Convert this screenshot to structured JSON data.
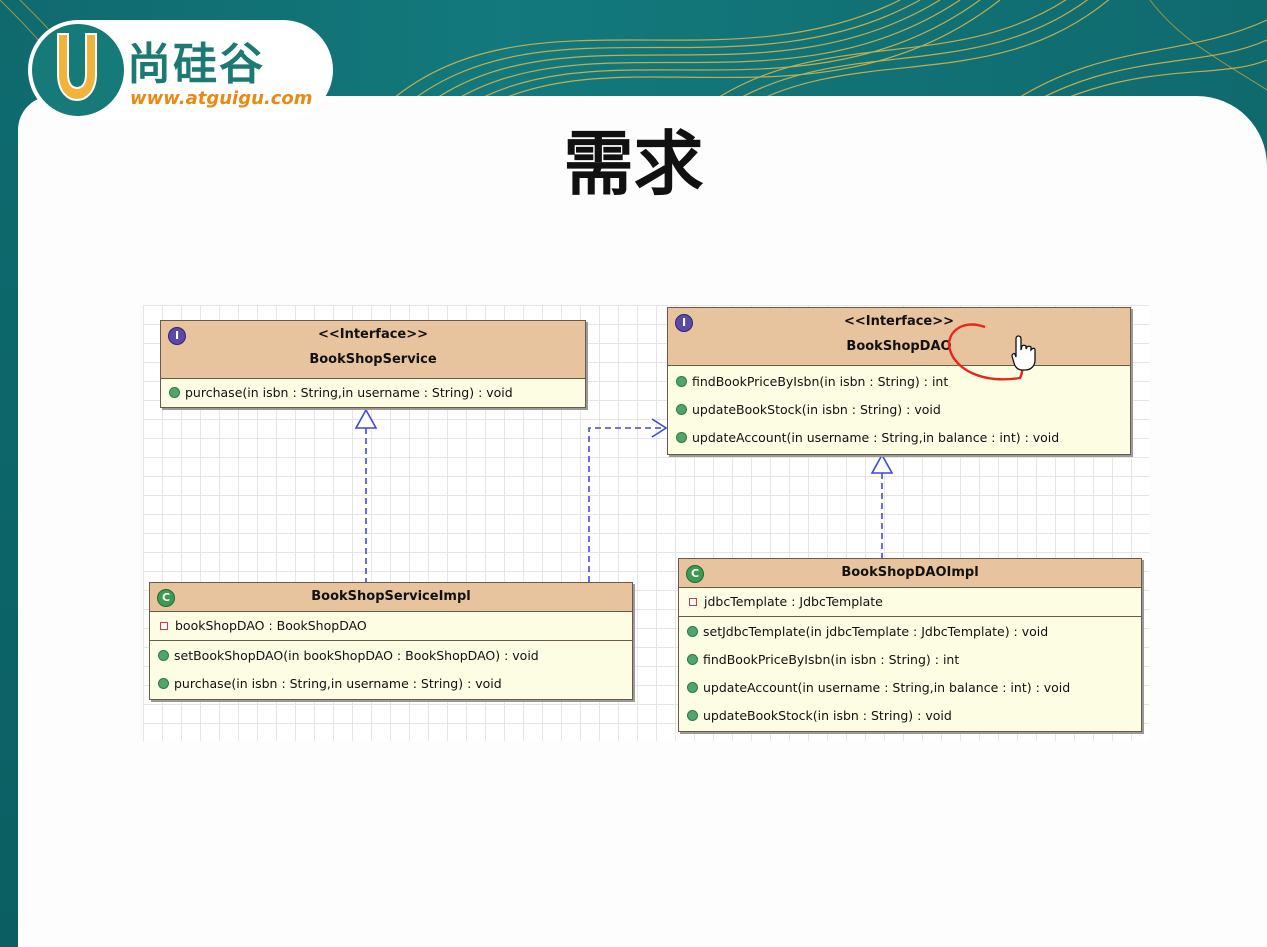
{
  "logo": {
    "brand_text": "尚硅谷",
    "url_text": "www.atguigu.com"
  },
  "slide": {
    "title": "需求"
  },
  "diagram": {
    "classes": [
      {
        "id": "book-shop-service",
        "kind_badge": "I",
        "stereotype": "<<Interface>>",
        "name": "BookShopService",
        "fields": [],
        "methods": [
          "purchase(in isbn : String,in username : String) : void"
        ]
      },
      {
        "id": "book-shop-dao",
        "kind_badge": "I",
        "stereotype": "<<Interface>>",
        "name": "BookShopDAO",
        "fields": [],
        "methods": [
          "findBookPriceByIsbn(in isbn : String) : int",
          "updateBookStock(in isbn : String) : void",
          "updateAccount(in username : String,in balance : int) : void"
        ]
      },
      {
        "id": "book-shop-service-impl",
        "kind_badge": "C",
        "stereotype": "",
        "name": "BookShopServiceImpl",
        "fields": [
          "bookShopDAO : BookShopDAO"
        ],
        "methods": [
          "setBookShopDAO(in bookShopDAO : BookShopDAO) : void",
          "purchase(in isbn : String,in username : String) : void"
        ]
      },
      {
        "id": "book-shop-dao-impl",
        "kind_badge": "C",
        "stereotype": "",
        "name": "BookShopDAOImpl",
        "fields": [
          "jdbcTemplate : JdbcTemplate"
        ],
        "methods": [
          "setJdbcTemplate(in jdbcTemplate : JdbcTemplate) : void",
          "findBookPriceByIsbn(in isbn : String) : int",
          "updateAccount(in username : String,in balance : int) : void",
          "updateBookStock(in isbn : String) : void"
        ]
      }
    ],
    "relations": [
      {
        "type": "realization",
        "from": "book-shop-service-impl",
        "to": "book-shop-service"
      },
      {
        "type": "realization",
        "from": "book-shop-dao-impl",
        "to": "book-shop-dao"
      },
      {
        "type": "dependency",
        "from": "book-shop-service-impl",
        "to": "book-shop-dao"
      }
    ]
  },
  "colors": {
    "header": "#e8c49e",
    "body": "#fdfde3",
    "connector": "#3f49d8",
    "annotation": "#e8261c",
    "brand": "#1c7a73",
    "url": "#e88a14"
  }
}
